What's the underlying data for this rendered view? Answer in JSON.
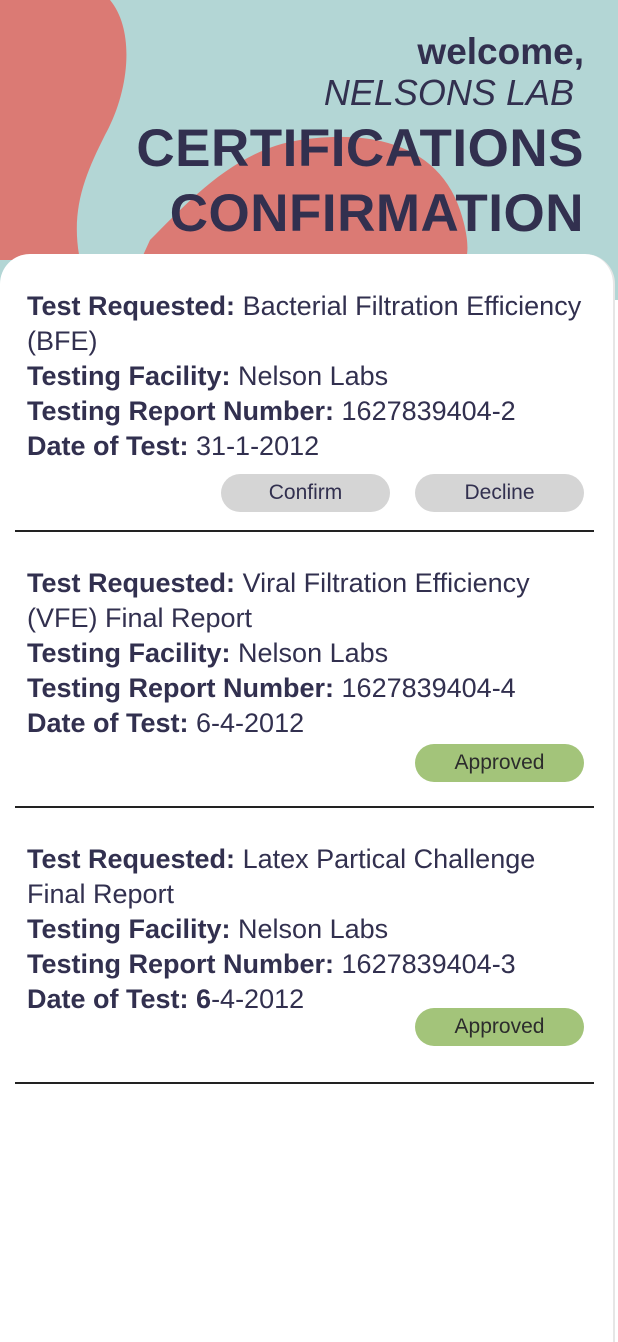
{
  "header": {
    "welcome": "welcome,",
    "lab_name": "NELSONS LAB",
    "title_line1": "CERTIFICATIONS",
    "title_line2": "CONFIRMATION"
  },
  "labels": {
    "test_requested": "Test Requested:",
    "testing_facility": "Testing Facility:",
    "report_number": "Testing Report Number:",
    "date_of_test": "Date of Test:"
  },
  "certifications": [
    {
      "test_requested": "Bacterial Filtration Efficiency (BFE)",
      "facility": "Nelson Labs",
      "report_number": "1627839404-2",
      "date": "31-1-2012",
      "confirm_label": "Confirm",
      "decline_label": "Decline"
    },
    {
      "test_requested": "Viral Filtration Efficiency (VFE) Final Report",
      "facility": "Nelson Labs",
      "report_number": "1627839404-4",
      "date": "6-4-2012",
      "status": "Approved"
    },
    {
      "test_requested": "Latex Partical Challenge Final Report",
      "facility": "Nelson Labs",
      "report_number": "1627839404-3",
      "date_bold_part": "6",
      "date": "-4-2012",
      "status": "Approved"
    }
  ],
  "colors": {
    "background_teal": "#b3d6d5",
    "blob_coral": "#db7a74",
    "text_dark": "#32304f",
    "button_grey": "#d5d5d5",
    "approved_green": "#a3c47a"
  }
}
